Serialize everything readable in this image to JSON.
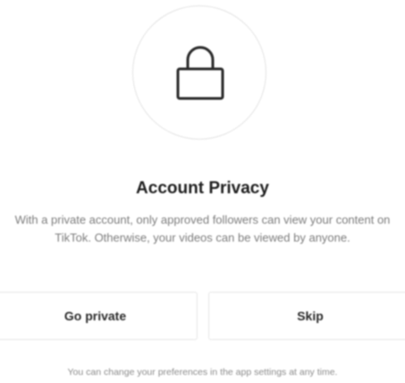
{
  "privacy_prompt": {
    "icon": "lock-icon",
    "title": "Account Privacy",
    "description": "With a private account, only approved followers can view your content on TikTok. Otherwise, your videos can be viewed by anyone.",
    "go_private_label": "Go private",
    "skip_label": "Skip",
    "footnote": "You can change your preferences in the app settings at any time."
  },
  "colors": {
    "background": "#ffffff",
    "title": "#1f1f1f",
    "secondary_text": "#7d7d7d",
    "border": "#e6e6e6"
  }
}
